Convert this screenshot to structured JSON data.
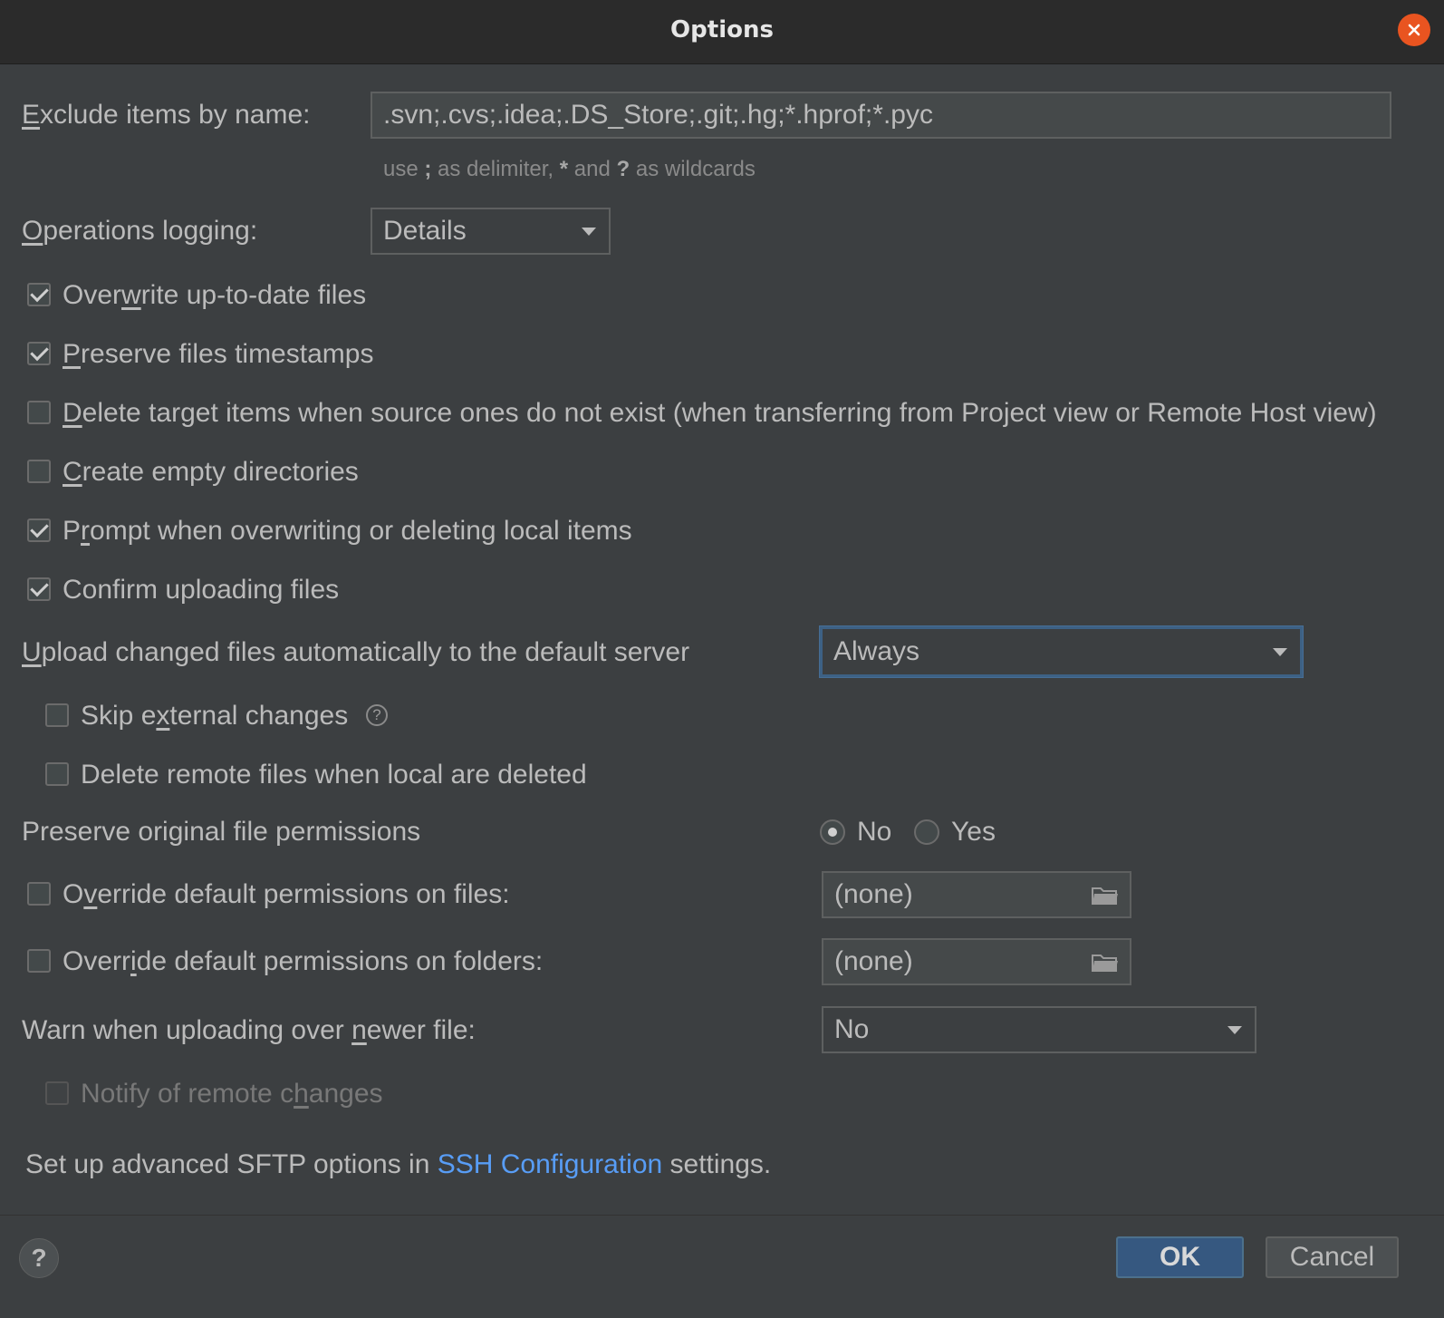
{
  "dialog": {
    "title": "Options"
  },
  "exclude": {
    "label_pre": "",
    "label_u": "E",
    "label_post": "xclude items by name:",
    "value": ".svn;.cvs;.idea;.DS_Store;.git;.hg;*.hprof;*.pyc",
    "hint_1": "use ",
    "hint_2": ";",
    "hint_3": " as delimiter, ",
    "hint_4": "*",
    "hint_5": " and ",
    "hint_6": "?",
    "hint_7": " as wildcards"
  },
  "logging": {
    "label_pre": "",
    "label_u": "O",
    "label_post": "perations logging:",
    "value": "Details"
  },
  "checks": {
    "overwrite": {
      "checked": true,
      "pre": "Over",
      "u": "w",
      "post": "rite up-to-date files"
    },
    "preserve_ts": {
      "checked": true,
      "pre": "",
      "u": "P",
      "post": "reserve files timestamps"
    },
    "delete_target": {
      "checked": false,
      "pre": "",
      "u": "D",
      "post": "elete target items when source ones do not exist (when transferring from Project view or Remote Host view)"
    },
    "create_empty": {
      "checked": false,
      "pre": "",
      "u": "C",
      "post": "reate empty directories"
    },
    "prompt_overwrite": {
      "checked": true,
      "pre": "P",
      "u": "r",
      "post": "ompt when overwriting or deleting local items"
    },
    "confirm_upload": {
      "checked": true,
      "pre": "Confirm uploading files",
      "u": "",
      "post": ""
    }
  },
  "upload_auto": {
    "label_pre": "",
    "label_u": "U",
    "label_post": "pload changed files automatically to the default server",
    "value": "Always"
  },
  "skip_external": {
    "checked": false,
    "pre": "Skip e",
    "u": "x",
    "post": "ternal changes",
    "help_icon": "question-circle"
  },
  "delete_remote": {
    "checked": false,
    "label": "Delete remote files when local are deleted"
  },
  "permissions": {
    "label": "Preserve original file permissions",
    "selected": "No",
    "option_no": "No",
    "option_yes": "Yes"
  },
  "override_files": {
    "checked": false,
    "pre": "O",
    "u": "v",
    "post": "erride default permissions on files:",
    "value": "(none)",
    "icon": "folder-icon"
  },
  "override_folders": {
    "checked": false,
    "pre": "Overr",
    "u": "i",
    "post": "de default permissions on folders:",
    "value": "(none)",
    "icon": "folder-icon"
  },
  "warn_newer": {
    "label_pre": "Warn when uploading over ",
    "label_u": "n",
    "label_post": "ewer file:",
    "value": "No"
  },
  "notify_remote": {
    "checked": false,
    "disabled": true,
    "pre": "Notify of remote c",
    "u": "h",
    "post": "anges"
  },
  "sftp_note": {
    "pre": "Set up advanced SFTP options in ",
    "link": "SSH Configuration",
    "post": " settings."
  },
  "footer": {
    "help": "?",
    "ok": "OK",
    "cancel": "Cancel"
  },
  "colors": {
    "background": "#3c3f41",
    "accent": "#365880",
    "link": "#589df6",
    "close": "#e95420"
  }
}
